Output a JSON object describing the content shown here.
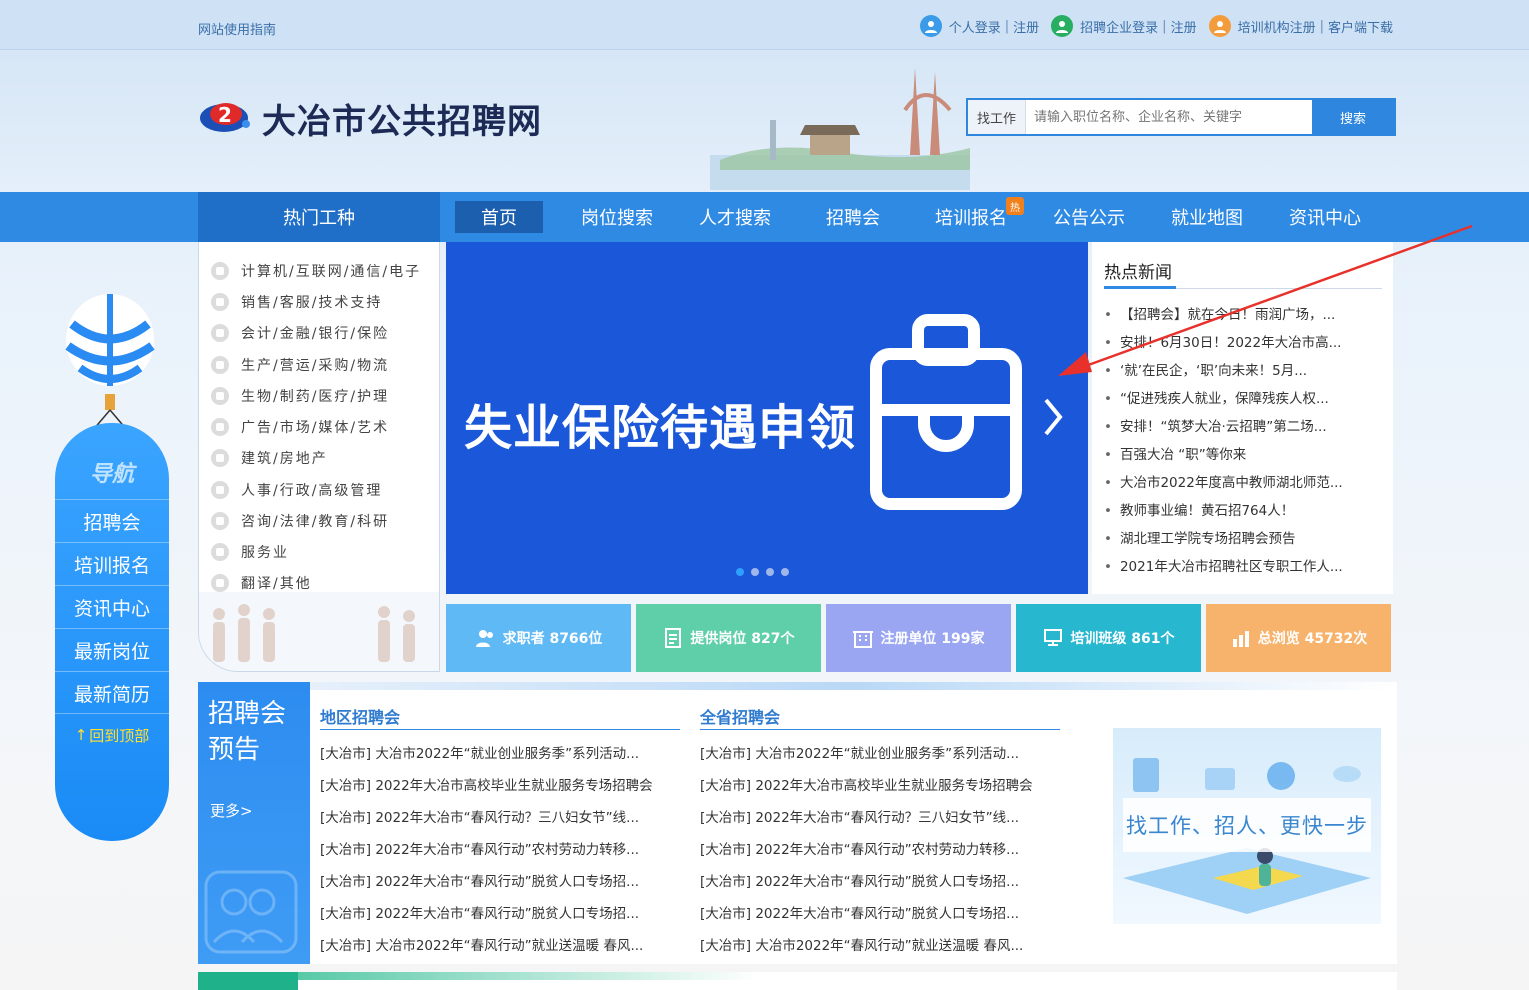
{
  "topbar": {
    "guide": "网站使用指南",
    "personal_login": "个人登录",
    "register1": "注册",
    "company_login": "招聘企业登录",
    "register2": "注册",
    "training_register": "培训机构注册",
    "client_download": "客户端下载",
    "sep": "|"
  },
  "header": {
    "site_title": "大冶市公共招聘网",
    "search_category": "找工作",
    "search_placeholder": "请输入职位名称、企业名称、关键字",
    "search_button": "搜索"
  },
  "nav": {
    "hot_jobs": "热门工种",
    "items": [
      "首页",
      "岗位搜索",
      "人才搜索",
      "招聘会",
      "培训报名",
      "公告公示",
      "就业地图",
      "资讯中心"
    ],
    "hot_badge": "热"
  },
  "categories": [
    "计算机/互联网/通信/电子",
    "销售/客服/技术支持",
    "会计/金融/银行/保险",
    "生产/营运/采购/物流",
    "生物/制药/医疗/护理",
    "广告/市场/媒体/艺术",
    "建筑/房地产",
    "人事/行政/高级管理",
    "咨询/法律/教育/科研",
    "服务业",
    "翻译/其他"
  ],
  "banner": {
    "text": "失业保险待遇申领",
    "slide_count": 4,
    "active_slide": 1
  },
  "news": {
    "title": "热点新闻",
    "items": [
      "【招聘会】就在今日！雨润广场，...",
      "安排！6月30日！2022年大冶市高...",
      "‘就’在民企，‘职’向未来！5月...",
      "“促进残疾人就业，保障残疾人权...",
      "安排！“筑梦大冶·云招聘”第二场...",
      "百强大冶 “职”等你来",
      "大冶市2022年度高中教师湖北师范...",
      "教师事业编！黄石招764人！",
      "湖北理工学院专场招聘会预告",
      "2021年大冶市招聘社区专职工作人..."
    ]
  },
  "stats": [
    {
      "label": "求职者 8766位",
      "color": "#5fb9f5"
    },
    {
      "label": "提供岗位 827个",
      "color": "#5fcfa9"
    },
    {
      "label": "注册单位 199家",
      "color": "#9aa6f2"
    },
    {
      "label": "培训班级 861个",
      "color": "#27b7cf"
    },
    {
      "label": "总浏览 45732次",
      "color": "#f7b36c"
    }
  ],
  "sidenav": {
    "title": "导航",
    "items": [
      "招聘会",
      "培训报名",
      "资讯中心",
      "最新岗位",
      "最新简历"
    ],
    "back_top": "回到顶部"
  },
  "jobfair": {
    "title": "招聘会预告",
    "more": "更多>",
    "local_title": "地区招聘会",
    "province_title": "全省招聘会",
    "local_items": [
      "[大冶市] 大冶市2022年“就业创业服务季”系列活动...",
      "[大冶市] 2022年大冶市高校毕业生就业服务专场招聘会",
      "[大冶市] 2022年大冶市“春风行动？三八妇女节”线...",
      "[大冶市] 2022年大冶市“春风行动”农村劳动力转移...",
      "[大冶市] 2022年大冶市“春风行动”脱贫人口专场招...",
      "[大冶市] 2022年大冶市“春风行动”脱贫人口专场招...",
      "[大冶市] 大冶市2022年“春风行动”就业送温暖 春风..."
    ],
    "province_items": [
      "[大冶市] 大冶市2022年“就业创业服务季”系列活动...",
      "[大冶市] 2022年大冶市高校毕业生就业服务专场招聘会",
      "[大冶市] 2022年大冶市“春风行动？三八妇女节”线...",
      "[大冶市] 2022年大冶市“春风行动”农村劳动力转移...",
      "[大冶市] 2022年大冶市“春风行动”脱贫人口专场招...",
      "[大冶市] 2022年大冶市“春风行动”脱贫人口专场招...",
      "[大冶市] 大冶市2022年“春风行动”就业送温暖 春风..."
    ],
    "promo_text": "找工作、招人、更快一步"
  },
  "colors": {
    "nav_blue": "#2f8ae4",
    "nav_dark": "#1f6fc9",
    "banner_blue": "#1a57d9",
    "annotation_red": "#e8312a"
  }
}
